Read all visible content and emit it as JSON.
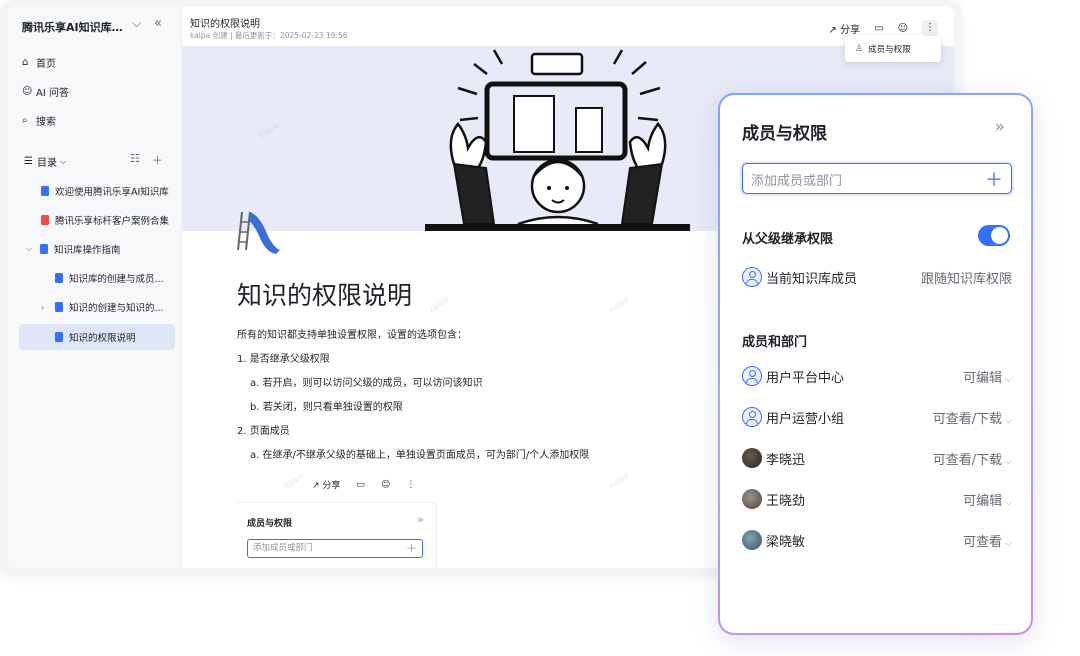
{
  "sidebar": {
    "kb_title": "腾讯乐享AI知识库使用...",
    "nav": [
      "首页",
      "AI 问答",
      "搜索"
    ],
    "toc_label": "目录",
    "tree": [
      {
        "label": "欢迎使用腾讯乐享AI知识库",
        "icon": "doc-icon"
      },
      {
        "label": "腾讯乐享标杆客户案例合集",
        "icon": "pdf-icon"
      },
      {
        "label": "知识库操作指南",
        "icon": "doc-icon"
      },
      {
        "label": "知识库的创建与成员...",
        "icon": "doc-icon"
      },
      {
        "label": "知识的创建与知识的...",
        "icon": "doc-icon"
      },
      {
        "label": "知识的权限说明",
        "icon": "doc-icon"
      }
    ]
  },
  "header": {
    "title": "知识的权限说明",
    "meta": "kalpa 创建 | 最后更新于：2025-02-23 19:56",
    "share": "分享"
  },
  "tooltip": {
    "label": "成员与权限"
  },
  "doc": {
    "heading": "知识的权限说明",
    "lines": [
      "所有的知识都支持单独设置权限，设置的选项包含：",
      "1.  是否继承父级权限",
      "a.  若开启，则可以访问父级的成员，可以访问该知识",
      "b.  若关闭，则只看单独设置的权限",
      "2.  页面成员",
      "a.  在继承/不继承父级的基础上，单独设置页面成员，可为部门/个人添加权限"
    ],
    "watermark": "kalpa"
  },
  "mini_panel": {
    "share": "分享",
    "title": "成员与权限",
    "placeholder": "添加成员或部门"
  },
  "panel": {
    "title": "成员与权限",
    "input_placeholder": "添加成员或部门",
    "inherit": {
      "label": "从父级继承权限",
      "enabled": true
    },
    "inherit_row": {
      "name": "当前知识库成员",
      "perm": "跟随知识库权限"
    },
    "members_title": "成员和部门",
    "members": [
      {
        "name": "用户平台中心",
        "perm": "可编辑",
        "avatar": "group-avatar"
      },
      {
        "name": "用户运营小组",
        "perm": "可查看/下载",
        "avatar": "group-avatar"
      },
      {
        "name": "李晓迅",
        "perm": "可查看/下载",
        "avatar": "user-avatar"
      },
      {
        "name": "王晓劲",
        "perm": "可编辑",
        "avatar": "user-avatar"
      },
      {
        "name": "梁晓敏",
        "perm": "可查看",
        "avatar": "user-avatar"
      }
    ],
    "accent": "#3370ff"
  }
}
